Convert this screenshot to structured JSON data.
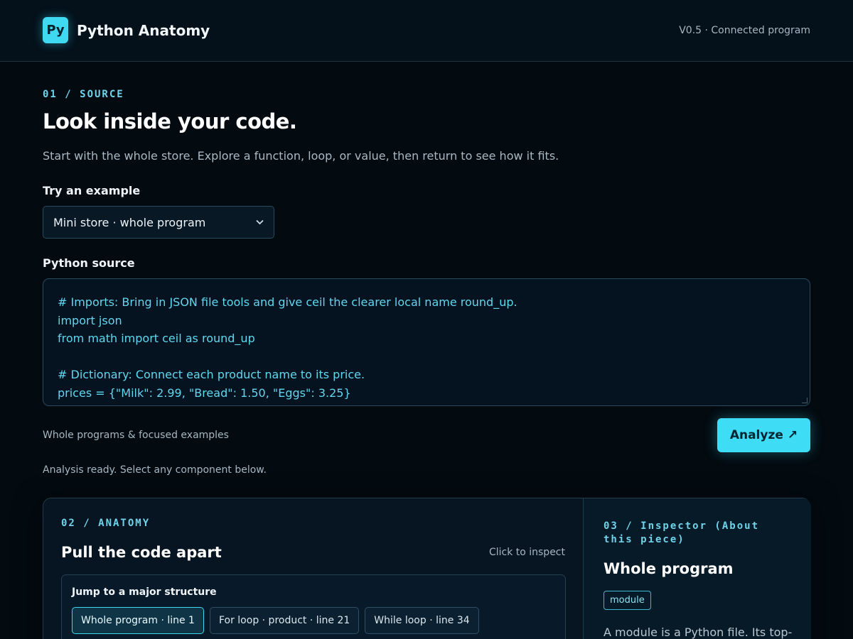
{
  "header": {
    "logo_text": "Py",
    "title": "Python Anatomy",
    "version": "V0.5 · Connected program"
  },
  "source": {
    "eyebrow": "01 / SOURCE",
    "title": "Look inside your code.",
    "lead": "Start with the whole store. Explore a function, loop, or value, then return to see how it fits.",
    "example_label": "Try an example",
    "example_selected": "Mini store · whole program",
    "source_label": "Python source",
    "code_lines": [
      "# Imports: Bring in JSON file tools and give ceil the clearer local name round_up.",
      "import json",
      "from math import ceil as round_up",
      "",
      "# Dictionary: Connect each product name to its price.",
      "prices = {\"Milk\": 2.99, \"Bread\": 1.50, \"Eggs\": 3.25}"
    ],
    "hint": "Whole programs & focused examples",
    "analyze_label": "Analyze",
    "analyze_icon": "↗",
    "status": "Analysis ready. Select any component below."
  },
  "anatomy": {
    "eyebrow": "02 / ANATOMY",
    "title": "Pull the code apart",
    "click_hint": "Click to inspect",
    "jump_title": "Jump to a major structure",
    "chips": [
      {
        "label": "Whole program · line 1",
        "active": true
      },
      {
        "label": "For loop · product · line 21",
        "active": false
      },
      {
        "label": "While loop · line 34",
        "active": false
      }
    ]
  },
  "inspector": {
    "eyebrow": "03 / Inspector (About this piece)",
    "title": "Whole program",
    "tag": "module",
    "description": "A module is a Python file. Its top-"
  },
  "colors": {
    "background": "#030a10",
    "accent": "#3fdcf5",
    "code_text": "#5fd8ef",
    "muted_text": "#a6b7c2"
  }
}
